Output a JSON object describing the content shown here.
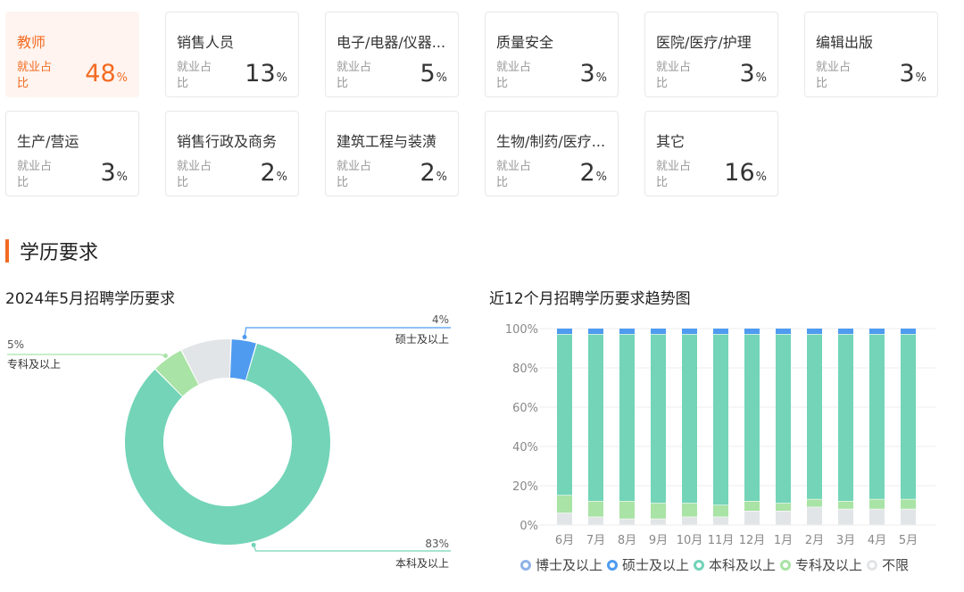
{
  "industries": [
    {
      "name": "教师",
      "sub": "就业占比",
      "value": "48",
      "unit": "%",
      "active": true
    },
    {
      "name": "销售人员",
      "sub": "就业占比",
      "value": "13",
      "unit": "%"
    },
    {
      "name": "电子/电器/仪器...",
      "sub": "就业占比",
      "value": "5",
      "unit": "%"
    },
    {
      "name": "质量安全",
      "sub": "就业占比",
      "value": "3",
      "unit": "%"
    },
    {
      "name": "医院/医疗/护理",
      "sub": "就业占比",
      "value": "3",
      "unit": "%"
    },
    {
      "name": "编辑出版",
      "sub": "就业占比",
      "value": "3",
      "unit": "%"
    },
    {
      "name": "生产/营运",
      "sub": "就业占比",
      "value": "3",
      "unit": "%"
    },
    {
      "name": "销售行政及商务",
      "sub": "就业占比",
      "value": "2",
      "unit": "%"
    },
    {
      "name": "建筑工程与装潢",
      "sub": "就业占比",
      "value": "2",
      "unit": "%"
    },
    {
      "name": "生物/制药/医疗...",
      "sub": "就业占比",
      "value": "2",
      "unit": "%"
    },
    {
      "name": "其它",
      "sub": "就业占比",
      "value": "16",
      "unit": "%"
    }
  ],
  "section": {
    "title": "学历要求"
  },
  "colors": {
    "accent": "#f26b22",
    "doctor": "#8fb3e8",
    "master": "#4f9bf0",
    "bachelor": "#73d4b8",
    "college": "#a9e3a5",
    "unlimited": "#e2e5e7"
  },
  "chart_data": [
    {
      "type": "pie",
      "title": "2024年5月招聘学历要求",
      "slices": [
        {
          "label": "硕士及以上",
          "value": 4,
          "value_label": "4%",
          "color": "#4f9bf0"
        },
        {
          "label": "本科及以上",
          "value": 83,
          "value_label": "83%",
          "color": "#73d4b8"
        },
        {
          "label": "专科及以上",
          "value": 5,
          "value_label": "5%",
          "color": "#a9e3a5"
        },
        {
          "label": "",
          "value": 8,
          "color": "#e2e5e7"
        }
      ]
    },
    {
      "type": "bar",
      "stacked": true,
      "title": "近12个月招聘学历要求趋势图",
      "categories": [
        "6月",
        "7月",
        "8月",
        "9月",
        "10月",
        "11月",
        "12月",
        "1月",
        "2月",
        "3月",
        "4月",
        "5月"
      ],
      "yticks": [
        "0%",
        "20%",
        "40%",
        "60%",
        "80%",
        "100%"
      ],
      "ylim": [
        0,
        100
      ],
      "series": [
        {
          "name": "不限",
          "color": "#e2e5e7",
          "values": [
            6,
            4,
            3,
            3,
            4,
            4,
            7,
            7,
            9,
            8,
            8,
            8
          ]
        },
        {
          "name": "专科及以上",
          "color": "#a9e3a5",
          "values": [
            9,
            8,
            9,
            8,
            7,
            6,
            5,
            4,
            4,
            4,
            5,
            5
          ]
        },
        {
          "name": "本科及以上",
          "color": "#73d4b8",
          "values": [
            82,
            85,
            85,
            86,
            86,
            87,
            85,
            86,
            84,
            85,
            84,
            84
          ]
        },
        {
          "name": "硕士及以上",
          "color": "#4f9bf0",
          "values": [
            3,
            3,
            3,
            3,
            3,
            3,
            3,
            3,
            3,
            3,
            3,
            3
          ]
        },
        {
          "name": "博士及以上",
          "color": "#8fb3e8",
          "values": [
            0,
            0,
            0,
            0,
            0,
            0,
            0,
            0,
            0,
            0,
            0,
            0
          ]
        }
      ],
      "legend": [
        "博士及以上",
        "硕士及以上",
        "本科及以上",
        "专科及以上",
        "不限"
      ],
      "legend_colors": [
        "#8fb3e8",
        "#4f9bf0",
        "#73d4b8",
        "#a9e3a5",
        "#e2e5e7"
      ]
    }
  ]
}
